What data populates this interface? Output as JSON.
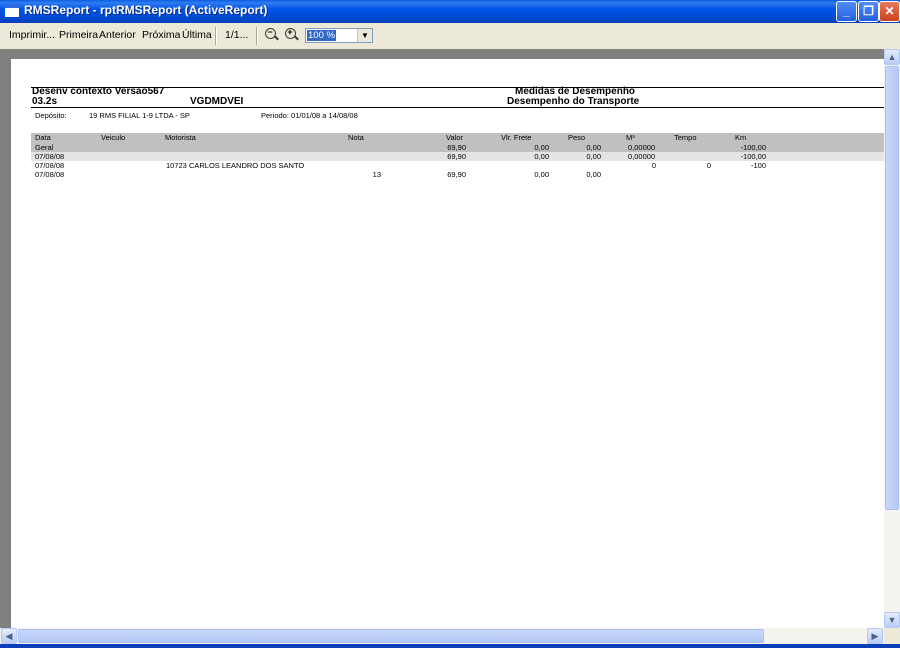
{
  "window": {
    "title": "RMSReport - rptRMSReport (ActiveReport)"
  },
  "toolbar": {
    "print": "Imprimir...",
    "first": "Primeira",
    "previous": "Anterior",
    "next": "Próxima",
    "last": "Última",
    "page_indicator": "1/1...",
    "zoom_value": "100 %"
  },
  "report": {
    "header": {
      "left_line1": "Desenv contexto Versao567",
      "left_line2": "03.2s",
      "code": "VGDMDVEI",
      "right_line1": "Medidas de Desempenho",
      "right_line2": "Desempenho do Transporte"
    },
    "info": {
      "deposit_label": "Depósito:",
      "deposit_value": "19  RMS FILIAL 1-9 LTDA - SP",
      "period": "Periodo: 01/01/08 a 14/08/08"
    },
    "columns": [
      "Data",
      "Veiculo",
      "Motorista",
      "Nota",
      "Valor",
      "Vlr. Frete",
      "Peso",
      "M³",
      "Tempo",
      "Km"
    ],
    "rows": [
      {
        "data": "Geral",
        "veiculo": "",
        "motorista": "",
        "nota": "",
        "valor": "69,90",
        "frete": "0,00",
        "peso": "0,00",
        "m3": "0,00000",
        "tempo": "",
        "km": "-100,00"
      },
      {
        "data": "07/08/08",
        "veiculo": "",
        "motorista": "",
        "nota": "",
        "valor": "69,90",
        "frete": "0,00",
        "peso": "0,00",
        "m3": "0,00000",
        "tempo": "",
        "km": "-100,00"
      },
      {
        "data": "07/08/08",
        "veiculo": "",
        "motorista": "10723 CARLOS LEANDRO DOS SANTO",
        "nota": "",
        "valor": "",
        "frete": "",
        "peso": "",
        "m3": "0",
        "tempo": "0",
        "km": "-100"
      },
      {
        "data": "07/08/08",
        "veiculo": "",
        "motorista": "",
        "nota": "13",
        "valor": "69,90",
        "frete": "0,00",
        "peso": "0,00",
        "m3": "",
        "tempo": "",
        "km": ""
      }
    ]
  },
  "colors": {
    "titlebar": "#0054e3",
    "toolbar": "#ece9d8",
    "viewer_bg": "#808080",
    "header_band": "#c0c0c0",
    "row_band": "#e4e4e4"
  }
}
